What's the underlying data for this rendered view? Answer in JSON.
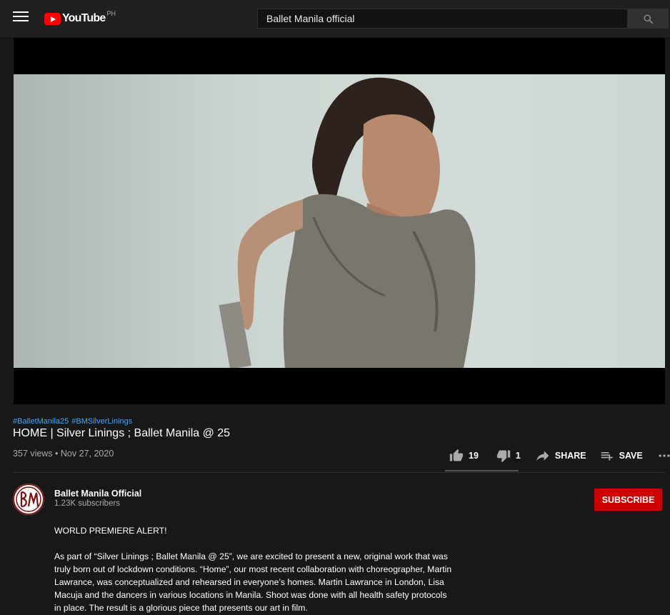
{
  "header": {
    "logo_text": "YouTube",
    "region": "PH",
    "search_value": "Ballet Manila official"
  },
  "video": {
    "hashtags": [
      "#BalletManila25",
      "#BMSilverLinings"
    ],
    "title": "HOME | Silver Linings ; Ballet Manila @ 25",
    "views_date": "357 views • Nov 27, 2020",
    "likes": "19",
    "dislikes": "1",
    "share_label": "SHARE",
    "save_label": "SAVE"
  },
  "channel": {
    "name": "Ballet Manila Official",
    "subscribers": "1.23K subscribers",
    "subscribe_label": "SUBSCRIBE",
    "avatar_initials": "BM"
  },
  "description": {
    "line1": "WORLD PREMIERE ALERT!",
    "paragraph": "As part of “Silver Linings ; Ballet Manila @ 25”, we are excited to present a new, original work that was truly born out of lockdown conditions.  “Home”, our most recent collaboration with choreographer, Martin Lawrance, was conceptualized and rehearsed in everyone’s homes.  Martin Lawrance in London, Lisa Macuja and the dancers in various locations in Manila.  Shoot was done with all health safety protocols in place.  The result is a glorious piece that presents our art in film."
  },
  "colors": {
    "background": "#181818",
    "topbar": "#202020",
    "link": "#3ea6ff",
    "subscribe": "#cc0000"
  }
}
